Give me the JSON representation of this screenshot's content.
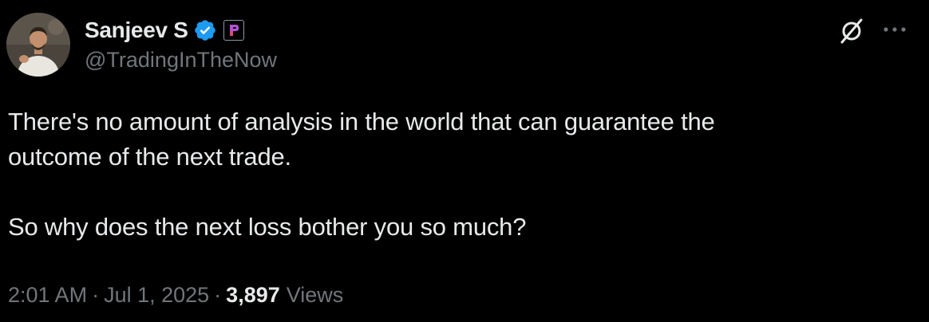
{
  "author": {
    "display_name": "Sanjeev S",
    "handle": "@TradingInTheNow",
    "verified": true,
    "verified_color": "#1d9bf0",
    "affiliate_badge_color": "#b44fd8"
  },
  "tweet": {
    "lines": [
      "There's no amount of analysis in the world that can guarantee the",
      "outcome of the next trade.",
      "So why does the next loss bother you so much?"
    ]
  },
  "meta": {
    "time": "2:01 AM",
    "separator": "·",
    "date": "Jul 1, 2025",
    "views_count": "3,897",
    "views_label": "Views"
  },
  "icons": {
    "top_right": [
      "grok-icon",
      "more-options-icon"
    ]
  },
  "colors": {
    "background": "#000000",
    "primary_text": "#e7e9ea",
    "secondary_text": "#71767b"
  }
}
